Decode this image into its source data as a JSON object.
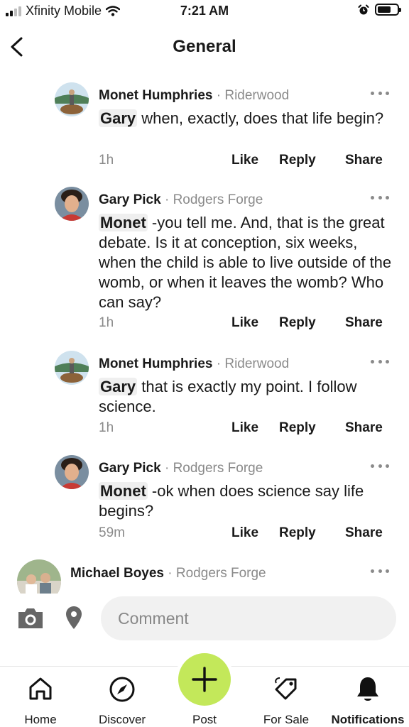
{
  "status_bar": {
    "carrier": "Xfinity Mobile",
    "time": "7:21 AM"
  },
  "header": {
    "title": "General"
  },
  "comments": [
    {
      "author": "Monet Humphries",
      "separator": "·",
      "location": "Riderwood",
      "mention": "Gary",
      "text": " when, exactly, does that life begin?",
      "time": "1h",
      "like": "Like",
      "reply": "Reply",
      "share": "Share"
    },
    {
      "author": "Gary Pick",
      "separator": "·",
      "location": "Rodgers Forge",
      "mention": "Monet",
      "text": " -you tell me.  And, that is the great debate.  Is it at conception, six weeks, when the child is able to live outside of the womb, or when it leaves the womb?  Who can say?",
      "time": "1h",
      "like": "Like",
      "reply": "Reply",
      "share": "Share"
    },
    {
      "author": "Monet Humphries",
      "separator": "·",
      "location": "Riderwood",
      "mention": "Gary",
      "text": " that is exactly my point. I follow science.",
      "time": "1h",
      "like": "Like",
      "reply": "Reply",
      "share": "Share"
    },
    {
      "author": "Gary Pick",
      "separator": "·",
      "location": "Rodgers Forge",
      "mention": "Monet",
      "text": " -ok when does science say life begins?",
      "time": "59m",
      "like": "Like",
      "reply": "Reply",
      "share": "Share"
    },
    {
      "author": "Michael Boyes",
      "separator": "·",
      "location": "Rodgers Forge"
    }
  ],
  "composer": {
    "placeholder": "Comment"
  },
  "tabs": {
    "home": "Home",
    "discover": "Discover",
    "post": "Post",
    "for_sale": "For Sale",
    "notifications": "Notifications"
  },
  "colors": {
    "post_button": "#c3e85a",
    "secondary_text": "#8a8a8a"
  }
}
